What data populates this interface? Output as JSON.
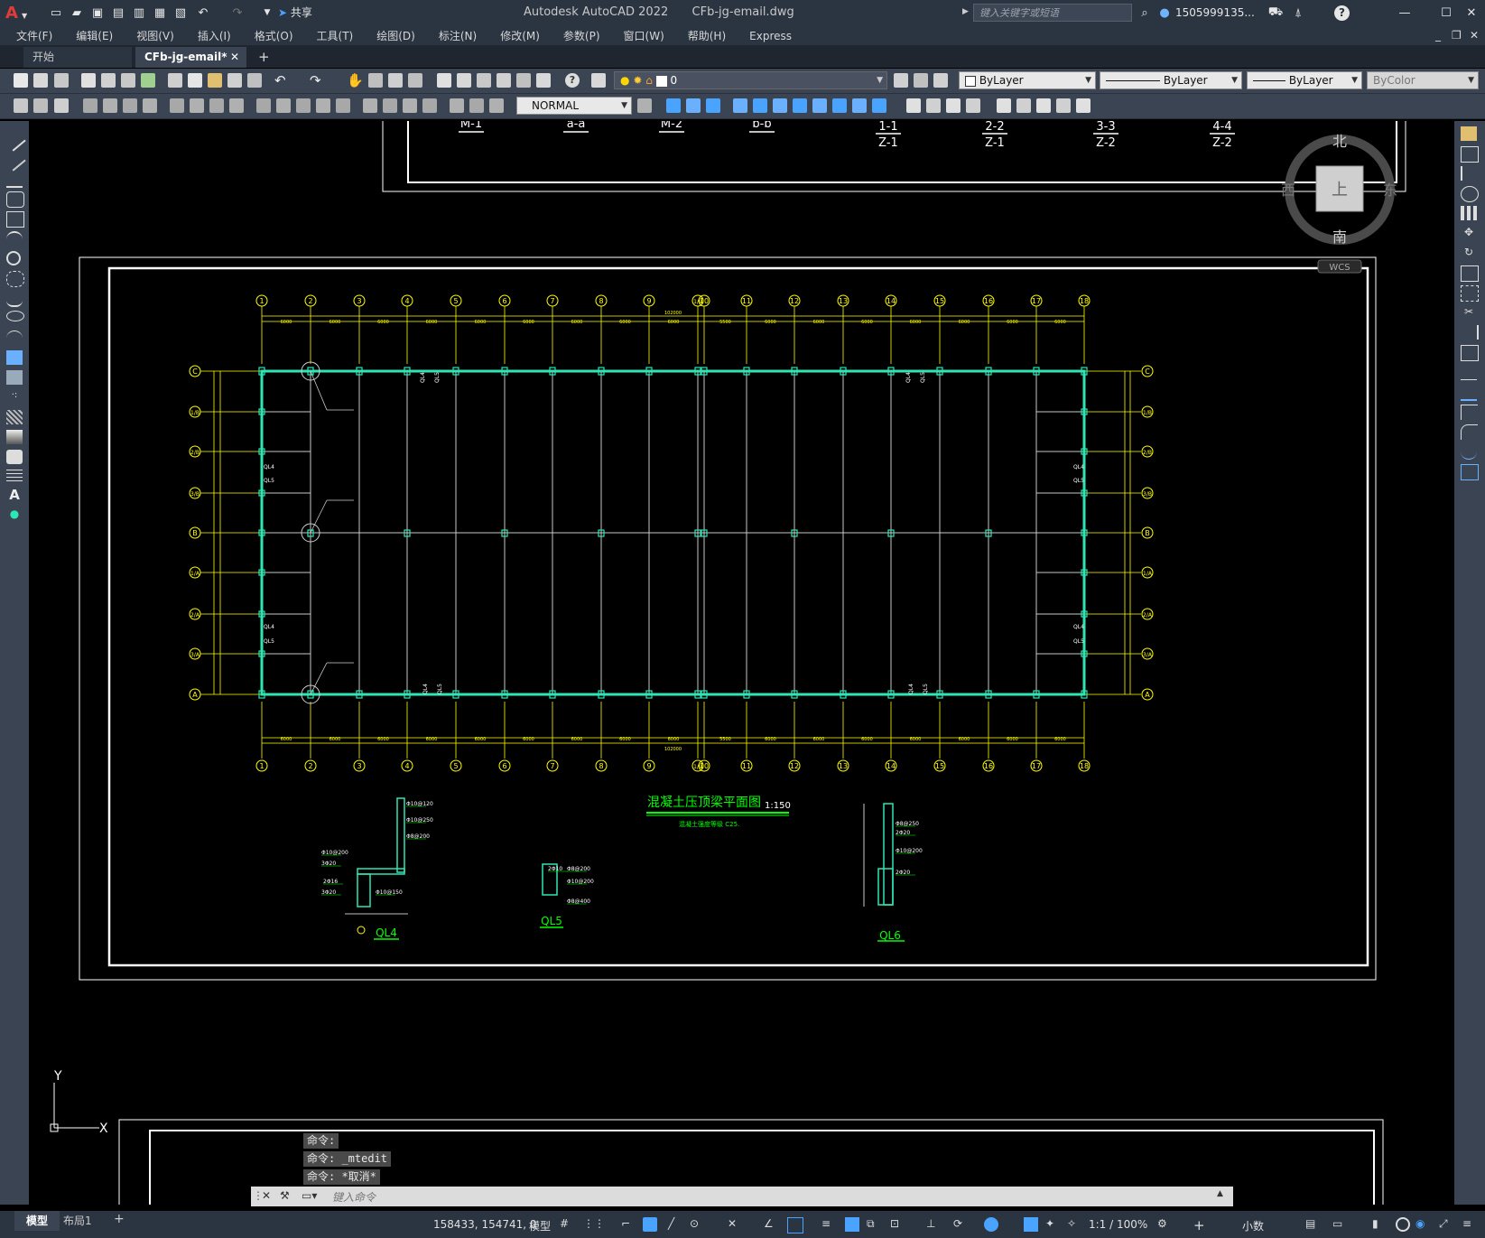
{
  "app": {
    "logo_glyph": "A",
    "title": "Autodesk AutoCAD 2022",
    "filename": "CFb-jg-email.dwg",
    "share_label": "共享",
    "search_placeholder": "键入关键字或短语",
    "user": "1505999135...",
    "help_glyph": "?"
  },
  "menus": [
    "文件(F)",
    "编辑(E)",
    "视图(V)",
    "插入(I)",
    "格式(O)",
    "工具(T)",
    "绘图(D)",
    "标注(N)",
    "修改(M)",
    "参数(P)",
    "窗口(W)",
    "帮助(H)",
    "Express"
  ],
  "tabs": {
    "start": "开始",
    "active": "CFb-jg-email*",
    "close_glyph": "✕",
    "new_glyph": "+"
  },
  "properties": {
    "layer": "0",
    "color": "ByLayer",
    "linetype": "ByLayer",
    "lineweight": "ByLayer",
    "plotstyle": "ByColor",
    "dimstyle": "NORMAL"
  },
  "viewcube": {
    "north": "北",
    "south": "南",
    "west": "西",
    "east": "东",
    "face": "上",
    "wcs": "WCS"
  },
  "drawing": {
    "top_labels": [
      "M-1",
      "a-a",
      "M-2",
      "b-b",
      "1-1",
      "2-2",
      "3-3",
      "4-4"
    ],
    "top_sublabels": [
      "Z-1",
      "Z-1",
      "Z-2",
      "Z-2"
    ],
    "axis_numbers": [
      "1",
      "2",
      "3",
      "4",
      "5",
      "6",
      "7",
      "8",
      "9",
      "1/9",
      "10",
      "11",
      "12",
      "13",
      "14",
      "15",
      "16",
      "17",
      "18"
    ],
    "row_letters": [
      "C",
      "1/B",
      "2/B",
      "3/B",
      "B",
      "1/A",
      "2/A",
      "3/A",
      "A"
    ],
    "span_labels": [
      "6000",
      "6000",
      "6000",
      "6000",
      "6000",
      "6000",
      "6000",
      "6000",
      "6000",
      "5500",
      "6000",
      "6000",
      "6000",
      "6000",
      "6000",
      "6000",
      "6000"
    ],
    "total_label": "102000",
    "beam_labels": [
      "QL4",
      "QL5",
      "QL6",
      "QL5"
    ],
    "plan_title": "混凝土压顶梁平面图",
    "plan_scale": "1:150",
    "plan_note": "混凝土强度等级 C25.",
    "detail_titles": [
      "QL4",
      "QL5",
      "QL6"
    ],
    "rebar_notes": [
      "Φ10@120",
      "Φ10@250",
      "Φ8@200",
      "Φ10@200",
      "3Φ20",
      "2Φ16",
      "3Φ20",
      "Φ10@150",
      "2Φ10",
      "Φ8@200",
      "Φ10@200",
      "Φ8@400",
      "Φ8@250",
      "2Φ20",
      "Φ10@200",
      "2Φ20"
    ]
  },
  "command": {
    "history": [
      "命令:",
      "命令: _mtedit",
      "命令: *取消*"
    ],
    "placeholder": "键入命令"
  },
  "ucs": {
    "y": "Y",
    "x": "X"
  },
  "status": {
    "model_tab": "模型",
    "layout_tab": "布局1",
    "add_glyph": "+",
    "coords": "158433, 154741, 0",
    "model_label": "模型",
    "scale": "1:1 / 100%",
    "units": "小数"
  },
  "colors": {
    "cyan": "#2ee6b4",
    "yellow": "#ffff00",
    "green": "#00ff00",
    "accent_red": "#e23b3b",
    "ui_dark": "#2b3441"
  }
}
